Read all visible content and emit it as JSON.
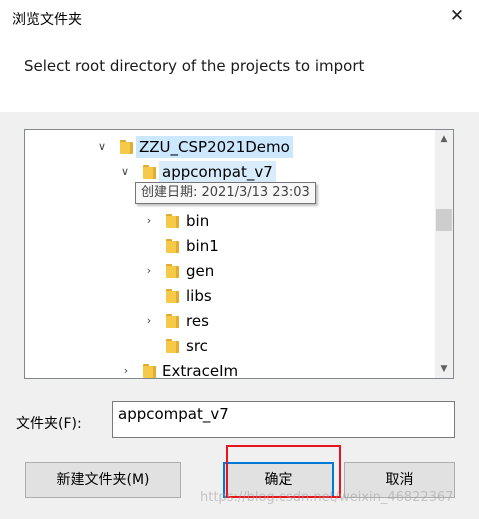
{
  "window": {
    "title": "浏览文件夹",
    "close_glyph": "✕"
  },
  "instruction": "Select root directory of the projects to import",
  "tree": {
    "nodes": [
      {
        "label": "ZZU_CSP2021Demo",
        "expander": "expanded",
        "selected": true
      },
      {
        "label": "appcompat_v7",
        "expander": "expanded",
        "selected": true
      },
      {
        "label": "bin",
        "expander": "collapsed"
      },
      {
        "label": "bin1",
        "expander": "none"
      },
      {
        "label": "gen",
        "expander": "collapsed"
      },
      {
        "label": "libs",
        "expander": "none"
      },
      {
        "label": "res",
        "expander": "collapsed"
      },
      {
        "label": "src",
        "expander": "none"
      },
      {
        "label": "ExtraceIm",
        "expander": "collapsed"
      }
    ],
    "tooltip": "创建日期: 2021/3/13 23:03",
    "glyphs": {
      "expanded": "∨",
      "collapsed": "›"
    }
  },
  "scrollbar": {
    "up_icon": "▲",
    "down_icon": "▼"
  },
  "folder_field": {
    "label": "文件夹(F):",
    "value": "appcompat_v7"
  },
  "buttons": {
    "new_folder": "新建文件夹(M)",
    "ok": "确定",
    "cancel": "取消"
  },
  "watermark": "https://blog.csdn.net/weixin_46822367",
  "colors": {
    "accent": "#0078d7",
    "selection": "#cce8ff",
    "annotation_box": "#e8161c",
    "folder": "#f7c948"
  }
}
